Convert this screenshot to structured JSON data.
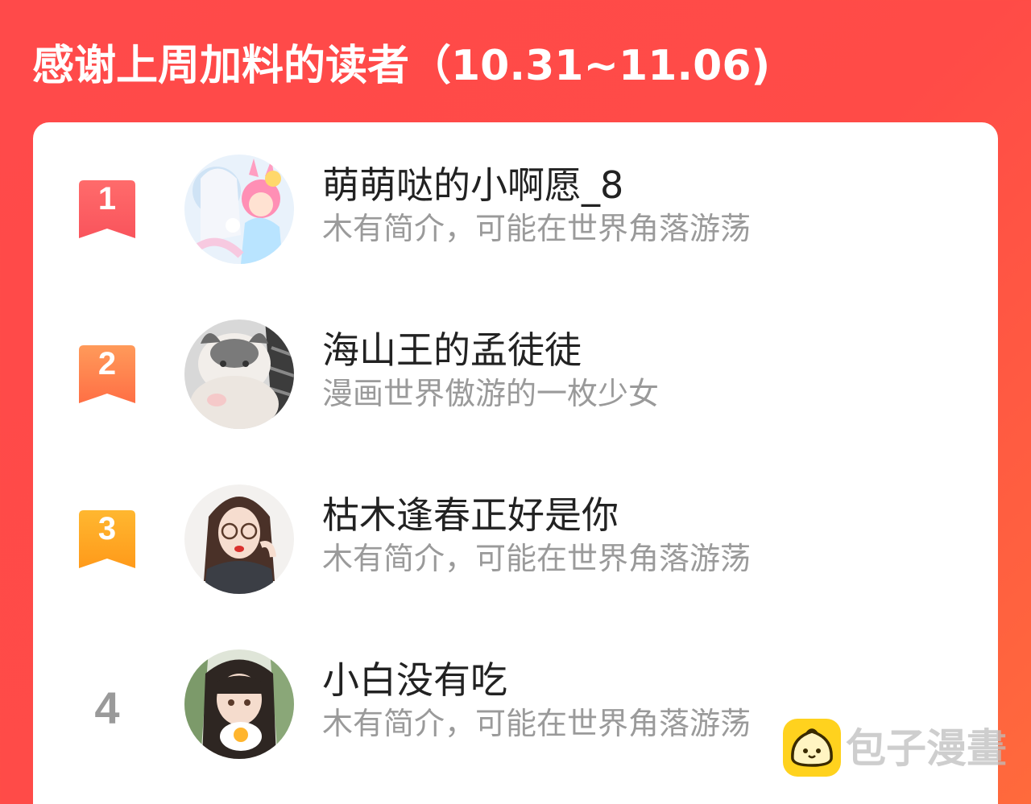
{
  "header": {
    "title": "感谢上周加料的读者（10.31~11.06)"
  },
  "readers": [
    {
      "rank": "1",
      "name": "萌萌哒的小啊愿_8",
      "bio": "木有简介，可能在世界角落游荡",
      "badge_color": "#f9545c"
    },
    {
      "rank": "2",
      "name": "海山王的孟徒徒",
      "bio": "漫画世界傲游的一枚少女",
      "badge_color": "#ff7a4d"
    },
    {
      "rank": "3",
      "name": "枯木逢春正好是你",
      "bio": "木有简介，可能在世界角落游荡",
      "badge_color": "#ffa21e"
    },
    {
      "rank": "4",
      "name": "小白没有吃",
      "bio": "木有简介，可能在世界角落游荡",
      "badge_color": ""
    }
  ],
  "watermark": {
    "text": "包子漫畫",
    "icon": "bun-icon",
    "icon_color": "#ffd21e"
  },
  "colors": {
    "background": "#ff4a4a",
    "card": "#ffffff",
    "name_text": "#222222",
    "bio_text": "#9a9a9a"
  }
}
